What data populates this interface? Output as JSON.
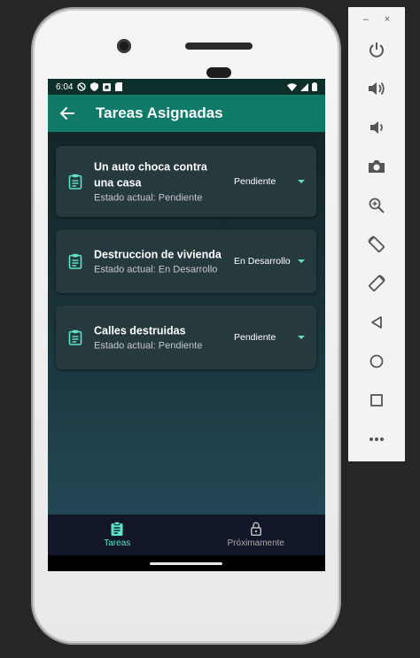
{
  "status_bar": {
    "time": "6:04"
  },
  "app_bar": {
    "title": "Tareas Asignadas",
    "back_icon": "arrow-left-icon"
  },
  "tasks": [
    {
      "title_line1": "Un auto choca contra",
      "title_line2": "una casa",
      "status_text": "Estado actual: Pendiente",
      "selected_value": "Pendiente"
    },
    {
      "title_line1": "Destruccion de vivienda",
      "title_line2": "",
      "status_text": "Estado actual: En Desarrollo",
      "selected_value": "En Desarrollo"
    },
    {
      "title_line1": "Calles destruidas",
      "title_line2": "",
      "status_text": "Estado actual: Pendiente",
      "selected_value": "Pendiente"
    }
  ],
  "bottom_nav": [
    {
      "label": "Tareas",
      "icon": "clipboard-icon",
      "active": true
    },
    {
      "label": "Próximamente",
      "icon": "lock-icon",
      "active": false
    }
  ],
  "emulator_panel": {
    "minimize": "–",
    "close": "×",
    "buttons": [
      "power-icon",
      "volume-up-icon",
      "volume-down-icon",
      "camera-icon",
      "zoom-icon",
      "rotate-left-icon",
      "rotate-right-icon",
      "back-icon",
      "home-icon",
      "overview-icon",
      "more-icon"
    ]
  },
  "colors": {
    "accent": "#5de3c6",
    "app_bar": "#0f7a68",
    "card": "#26393c",
    "bottom_nav": "#121629"
  }
}
